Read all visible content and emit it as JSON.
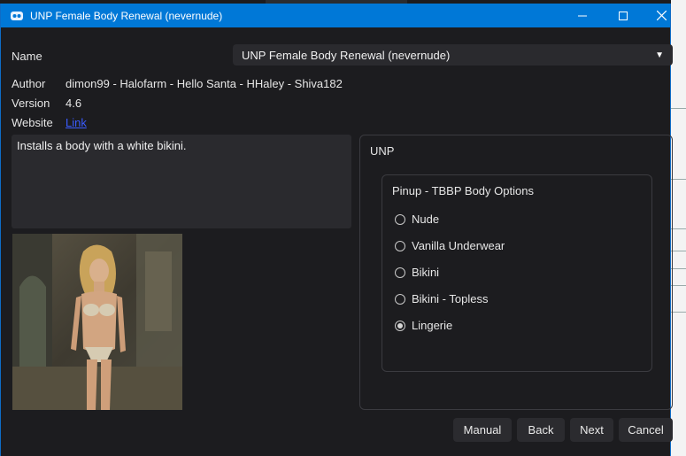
{
  "window": {
    "title": "UNP Female Body Renewal (nevernude)",
    "controls": {
      "minimize": "—",
      "maximize": "☐",
      "close": "✕"
    }
  },
  "fields": {
    "name_label": "Name",
    "name_value": "UNP Female Body Renewal (nevernude)",
    "author_label": "Author",
    "author_value": "dimon99 - Halofarm - Hello Santa - HHaley - Shiva182",
    "version_label": "Version",
    "version_value": "4.6",
    "website_label": "Website",
    "website_link": "Link"
  },
  "description": "Installs a body with a white bikini.",
  "group": {
    "title": "UNP",
    "inner_title": "Pinup - TBBP Body Options",
    "options": [
      {
        "label": "Nude",
        "checked": false
      },
      {
        "label": "Vanilla Underwear",
        "checked": false
      },
      {
        "label": "Bikini",
        "checked": false
      },
      {
        "label": "Bikini - Topless",
        "checked": false
      },
      {
        "label": "Lingerie",
        "checked": true
      }
    ]
  },
  "buttons": {
    "manual": "Manual",
    "back": "Back",
    "next": "Next",
    "cancel": "Cancel"
  },
  "colors": {
    "titlebar": "#0078d7",
    "background": "#1c1c1f",
    "field": "#2a2a2e",
    "link": "#3a5cff"
  }
}
